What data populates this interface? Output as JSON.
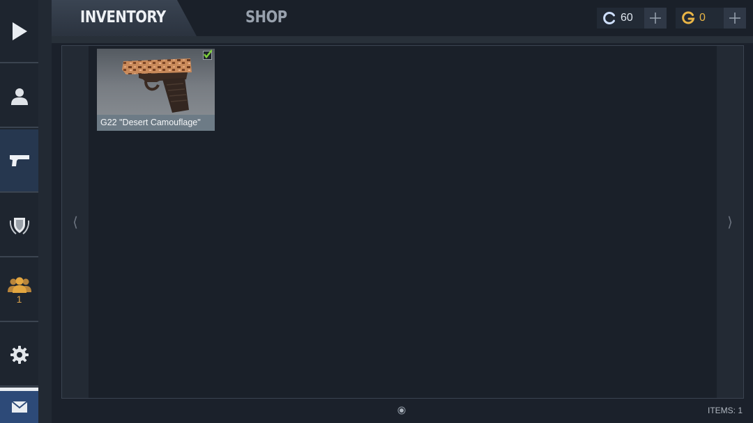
{
  "nav": {
    "tabs": [
      {
        "label": "INVENTORY",
        "active": true
      },
      {
        "label": "SHOP",
        "active": false
      }
    ]
  },
  "currencies": {
    "credits": {
      "amount": "60",
      "icon": "credits-icon",
      "color": "#cfe0ff"
    },
    "gold": {
      "amount": "0",
      "icon": "gold-icon",
      "color": "#e9b546"
    }
  },
  "sidebar": {
    "items": [
      {
        "icon": "play-icon"
      },
      {
        "icon": "profile-icon"
      },
      {
        "icon": "pistol-icon",
        "active": true
      },
      {
        "icon": "shield-icon"
      },
      {
        "icon": "friends-icon",
        "badge": "1"
      },
      {
        "icon": "gear-icon"
      },
      {
        "icon": "mail-icon"
      }
    ]
  },
  "inventory": {
    "items": [
      {
        "name": "G22 \"Desert Camouflage\"",
        "equipped": true,
        "icon": "pistol-skin-image"
      }
    ],
    "count_label": "ITEMS: 1",
    "pager": {
      "current": 1,
      "total": 1
    }
  },
  "colors": {
    "accent": "#26374f",
    "mail": "#2d4a78",
    "badge": "#d9a14a"
  }
}
